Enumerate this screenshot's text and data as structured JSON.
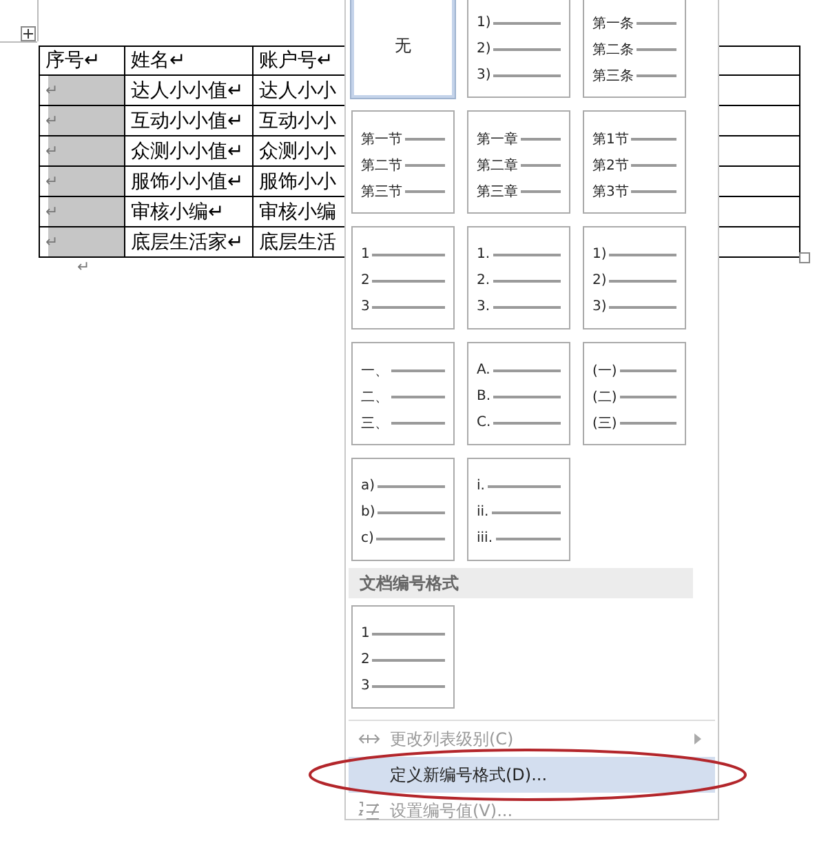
{
  "table": {
    "columns": [
      "序号↵",
      "姓名↵",
      "账户号↵"
    ],
    "rows": [
      {
        "number": {
          "text": "↵",
          "selected": true
        },
        "name": "达人小小值↵",
        "account": "达人小小"
      },
      {
        "number": {
          "text": "↵",
          "selected": true
        },
        "name": "互动小小值↵",
        "account": "互动小小"
      },
      {
        "number": {
          "text": "↵",
          "selected": true
        },
        "name": "众测小小值↵",
        "account": "众测小小"
      },
      {
        "number": {
          "text": "↵",
          "selected": true
        },
        "name": "服饰小小值↵",
        "account": "服饰小小"
      },
      {
        "number": {
          "text": "↵",
          "selected": true
        },
        "name": "审核小编↵",
        "account": "审核小编"
      },
      {
        "number": {
          "text": "↵",
          "selected": true
        },
        "name": "底层生活家↵",
        "account": "底层生活"
      }
    ],
    "paragraph_mark": "↵"
  },
  "menu": {
    "tiles": [
      {
        "kind": "none",
        "label": "无",
        "selected": true
      },
      {
        "kind": "list",
        "lines": [
          "1)",
          "2)",
          "3)"
        ],
        "selected": false
      },
      {
        "kind": "list",
        "lines": [
          "第一条",
          "第二条",
          "第三条"
        ],
        "selected": false
      },
      {
        "kind": "list",
        "lines": [
          "第一节",
          "第二节",
          "第三节"
        ],
        "selected": false
      },
      {
        "kind": "list",
        "lines": [
          "第一章",
          "第二章",
          "第三章"
        ],
        "selected": false
      },
      {
        "kind": "list",
        "lines": [
          "第1节",
          "第2节",
          "第3节"
        ],
        "selected": false
      },
      {
        "kind": "list",
        "lines": [
          "1",
          "2",
          "3"
        ],
        "selected": false
      },
      {
        "kind": "list",
        "lines": [
          "1.",
          "2.",
          "3."
        ],
        "selected": false
      },
      {
        "kind": "list",
        "lines": [
          "1)",
          "2)",
          "3)"
        ],
        "selected": false
      },
      {
        "kind": "list",
        "lines": [
          "一、",
          "二、",
          "三、"
        ],
        "selected": false
      },
      {
        "kind": "list",
        "lines": [
          "A.",
          "B.",
          "C."
        ],
        "selected": false
      },
      {
        "kind": "list",
        "lines": [
          "(一)",
          "(二)",
          "(三)"
        ],
        "selected": false
      },
      {
        "kind": "list",
        "lines": [
          "a)",
          "b)",
          "c)"
        ],
        "selected": false
      },
      {
        "kind": "list",
        "lines": [
          "i.",
          "ii.",
          "iii."
        ],
        "selected": false
      }
    ],
    "section_title": "文档编号格式",
    "document_tiles": [
      {
        "kind": "list",
        "lines": [
          "1",
          "2",
          "3"
        ],
        "selected": false
      }
    ],
    "items": [
      {
        "label": "更改列表级别(C)",
        "kind": "level",
        "disabled": true,
        "highlighted": false,
        "submenu": true,
        "circled": false
      },
      {
        "label": "定义新编号格式(D)...",
        "kind": "plain",
        "disabled": false,
        "highlighted": true,
        "submenu": false,
        "circled": true
      },
      {
        "label": "设置编号值(V)...",
        "kind": "numbering",
        "disabled": true,
        "highlighted": false,
        "submenu": false,
        "circled": false
      }
    ]
  }
}
